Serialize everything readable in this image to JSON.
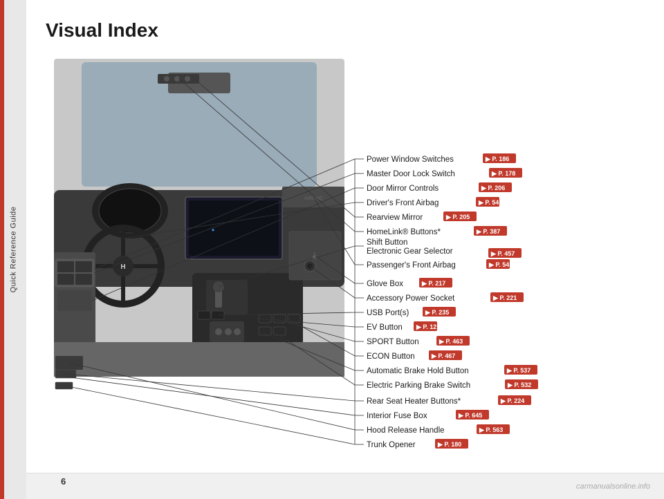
{
  "page": {
    "title": "Visual Index",
    "number": "6",
    "sidebar_label": "Quick Reference Guide"
  },
  "labels": [
    {
      "id": "power-window-switches",
      "name": "Power Window Switches",
      "page": "P. 186",
      "y_pct": 10
    },
    {
      "id": "master-door-lock",
      "name": "Master Door Lock Switch",
      "page": "P. 178",
      "y_pct": 16
    },
    {
      "id": "door-mirror-controls",
      "name": "Door Mirror Controls",
      "page": "P. 206",
      "y_pct": 22
    },
    {
      "id": "drivers-front-airbag",
      "name": "Driver's Front Airbag",
      "page": "P. 54",
      "y_pct": 28
    },
    {
      "id": "rearview-mirror",
      "name": "Rearview Mirror",
      "page": "P. 205",
      "y_pct": 34
    },
    {
      "id": "homelink-buttons",
      "name": "HomeLink® Buttons*",
      "page": "P. 387",
      "y_pct": 40
    },
    {
      "id": "shift-button",
      "name": "Shift Button",
      "page": "",
      "y_pct": 46
    },
    {
      "id": "electronic-gear-selector",
      "name": "Electronic Gear Selector",
      "page": "P. 457",
      "y_pct": 50
    },
    {
      "id": "passengers-front-airbag",
      "name": "Passenger's Front Airbag",
      "page": "P. 54",
      "y_pct": 56
    },
    {
      "id": "glove-box",
      "name": "Glove Box",
      "page": "P. 217",
      "y_pct": 62
    },
    {
      "id": "accessory-power-socket",
      "name": "Accessory Power Socket",
      "page": "P. 221",
      "y_pct": 67
    },
    {
      "id": "usb-ports",
      "name": "USB Port(s)",
      "page": "P. 235",
      "y_pct": 72
    },
    {
      "id": "ev-button",
      "name": "EV Button",
      "page": "P. 12",
      "y_pct": 77
    },
    {
      "id": "sport-button",
      "name": "SPORT Button",
      "page": "P. 463",
      "y_pct": 82
    },
    {
      "id": "econ-button",
      "name": "ECON Button",
      "page": "P. 467",
      "y_pct": 86
    },
    {
      "id": "automatic-brake-hold",
      "name": "Automatic Brake Hold Button",
      "page": "P. 537",
      "y_pct": 90
    },
    {
      "id": "electric-parking-brake",
      "name": "Electric Parking Brake Switch",
      "page": "P. 532",
      "y_pct": 94
    },
    {
      "id": "rear-seat-heater",
      "name": "Rear Seat Heater Buttons*",
      "page": "P. 224",
      "y_pct": 99
    },
    {
      "id": "interior-fuse-box",
      "name": "Interior Fuse Box",
      "page": "P. 645",
      "y_pct": 104
    },
    {
      "id": "hood-release-handle",
      "name": "Hood Release Handle",
      "page": "P. 563",
      "y_pct": 109
    },
    {
      "id": "trunk-opener",
      "name": "Trunk Opener",
      "page": "P. 180",
      "y_pct": 114
    }
  ],
  "watermark": "carmanualsonline.info",
  "colors": {
    "red_accent": "#c0392b",
    "sidebar_bg": "#e0e0e0",
    "sidebar_bar": "#c0392b",
    "text_dark": "#1a1a1a",
    "bottom_bar": "#f0f0f0"
  }
}
